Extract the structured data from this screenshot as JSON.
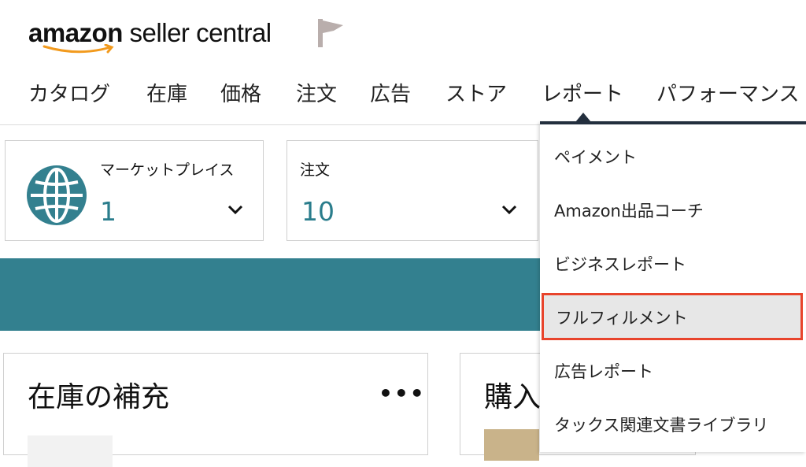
{
  "logo": {
    "brand": "amazon",
    "product": "seller central"
  },
  "nav": {
    "items": [
      {
        "label": "カタログ"
      },
      {
        "label": "在庫"
      },
      {
        "label": "価格"
      },
      {
        "label": "注文"
      },
      {
        "label": "広告"
      },
      {
        "label": "ストア"
      },
      {
        "label": "レポート"
      },
      {
        "label": "パフォーマンス"
      }
    ],
    "active": "レポート"
  },
  "widgets": [
    {
      "label": "マーケットプレイス",
      "value": "1"
    },
    {
      "label": "注文",
      "value": "10"
    }
  ],
  "cards": [
    {
      "title": "在庫の補充",
      "menu": "•••"
    },
    {
      "title": "購入"
    }
  ],
  "report_menu": {
    "items": [
      {
        "label": "ペイメント"
      },
      {
        "label": "Amazon出品コーチ"
      },
      {
        "label": "ビジネスレポート"
      },
      {
        "label": "フルフィルメント",
        "highlighted": true
      },
      {
        "label": "広告レポート"
      },
      {
        "label": "タックス関連文書ライブラリ"
      }
    ]
  },
  "colors": {
    "accent_teal": "#33808f",
    "value_teal": "#2a7d8c",
    "highlight_border": "#e8442c",
    "dropdown_top": "#232f3e",
    "smile_orange": "#f29a1d"
  },
  "icons": {
    "flag": "flag-icon",
    "globe": "globe-icon",
    "chevron": "chevron-down-icon",
    "menu": "more-icon"
  }
}
